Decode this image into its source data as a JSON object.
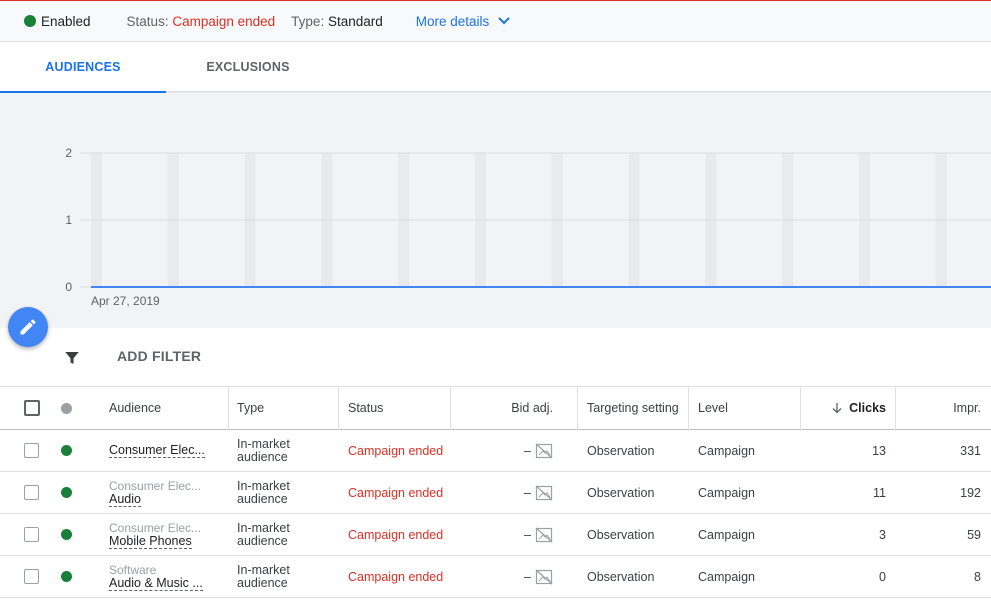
{
  "status_bar": {
    "enabled_label": "Enabled",
    "status_label": "Status:",
    "status_value": "Campaign ended",
    "type_label": "Type:",
    "type_value": "Standard",
    "more_details": "More details"
  },
  "tabs": [
    {
      "label": "AUDIENCES",
      "active": true
    },
    {
      "label": "EXCLUSIONS",
      "active": false
    }
  ],
  "chart_data": {
    "type": "line",
    "x_start_label": "Apr 27, 2019",
    "yticks": [
      0,
      1,
      2
    ],
    "ylim": [
      0,
      2
    ],
    "series": [
      {
        "values": [
          0,
          0,
          0,
          0,
          0,
          0,
          0,
          0,
          0,
          0,
          0,
          0,
          0,
          0,
          0,
          0,
          0,
          0,
          0,
          0,
          0,
          0,
          0,
          0,
          0,
          0
        ]
      }
    ],
    "colors": {
      "line": "#4285f4",
      "band": "#e8eaed",
      "grid": "#dadce0"
    }
  },
  "filter": {
    "add_filter_label": "ADD FILTER"
  },
  "table": {
    "headers": {
      "audience": "Audience",
      "type": "Type",
      "status": "Status",
      "bid_adj": "Bid adj.",
      "targeting": "Targeting setting",
      "level": "Level",
      "clicks": "Clicks",
      "impr": "Impr."
    },
    "rows": [
      {
        "parent": "",
        "name": "Consumer Elec...",
        "type1": "In-market",
        "type2": "audience",
        "status": "Campaign ended",
        "bid": "–",
        "targeting": "Observation",
        "level": "Campaign",
        "clicks": "13",
        "impr": "331"
      },
      {
        "parent": "Consumer Elec...",
        "name": "Audio",
        "type1": "In-market",
        "type2": "audience",
        "status": "Campaign ended",
        "bid": "–",
        "targeting": "Observation",
        "level": "Campaign",
        "clicks": "11",
        "impr": "192"
      },
      {
        "parent": "Consumer Elec...",
        "name": "Mobile Phones",
        "type1": "In-market",
        "type2": "audience",
        "status": "Campaign ended",
        "bid": "–",
        "targeting": "Observation",
        "level": "Campaign",
        "clicks": "3",
        "impr": "59"
      },
      {
        "parent": "Software",
        "name": "Audio & Music ...",
        "type1": "In-market",
        "type2": "audience",
        "status": "Campaign ended",
        "bid": "–",
        "targeting": "Observation",
        "level": "Campaign",
        "clicks": "0",
        "impr": "8"
      }
    ]
  },
  "colors": {
    "accent": "#1a73e8",
    "enabled_green": "#188038",
    "ended_red": "#d93025",
    "fab_blue": "#4285f4"
  }
}
